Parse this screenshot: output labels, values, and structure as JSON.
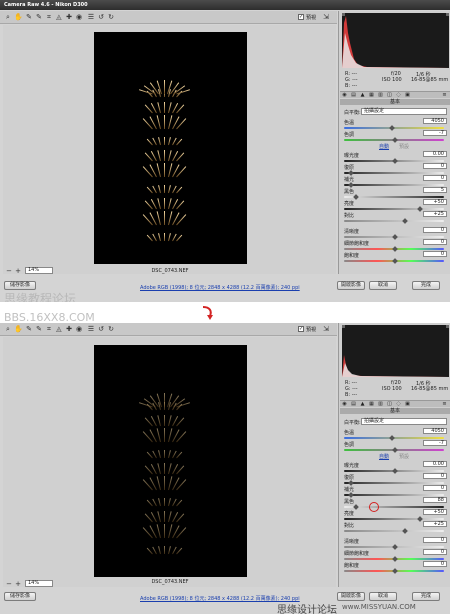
{
  "window": {
    "title": "Camera Raw 4.6  -  Nikon D300"
  },
  "toolbar": {
    "preview_label": "預視",
    "tools": [
      "zoom-tool",
      "hand-tool",
      "white-balance-tool",
      "color-sampler-tool",
      "crop-tool",
      "straighten-tool",
      "retouch-tool",
      "red-eye-tool",
      "preferences",
      "rotate-left",
      "rotate-right"
    ]
  },
  "image": {
    "filename": "DSC_0743.NEF",
    "zoom": "14%"
  },
  "info": {
    "r": "R:  ---",
    "g": "G:  ---",
    "b": "B:  ---",
    "aperture": "f/20",
    "shutter": "1/6 秒",
    "iso": "ISO 100",
    "lens": "16-85@85 mm"
  },
  "basic": {
    "tab_title": "基本",
    "wb_label": "白平衡:",
    "wb_value": "拍攝設定",
    "auto": "自動",
    "default": "預設",
    "rows": [
      {
        "label": "色溫",
        "value": "4050"
      },
      {
        "label": "色調",
        "value": "-7"
      },
      {
        "label": "曝光度",
        "value": "0.00"
      },
      {
        "label": "復原",
        "value": "0"
      },
      {
        "label": "補光",
        "value": "0"
      },
      {
        "label": "黑色",
        "value": "5"
      },
      {
        "label": "亮度",
        "value": "+50"
      },
      {
        "label": "對比",
        "value": "+25"
      },
      {
        "label": "清晰度",
        "value": "0"
      },
      {
        "label": "細節飽和度",
        "value": "0"
      },
      {
        "label": "飽和度",
        "value": "0"
      }
    ],
    "rows_after": [
      "0.00",
      "0",
      "0",
      "88",
      "+50",
      "+25",
      "0",
      "0",
      "0"
    ]
  },
  "bottom": {
    "save": "儲存影像",
    "workflow": "Adobe RGB (1998); 8 位元; 2848 x 4288 (12.2 百萬像素); 240 ppi",
    "open": "開啟影像",
    "cancel": "取消",
    "done": "完成"
  },
  "watermarks": {
    "left": "思缘教程论坛",
    "left_url": "BBS.16XX8.COM",
    "right_bottom": "思缘设计论坛",
    "right_url": "www.MISSYUAN.COM"
  },
  "colors": {
    "accent": "#1a3fae",
    "highlight_circle": "#d22020"
  }
}
